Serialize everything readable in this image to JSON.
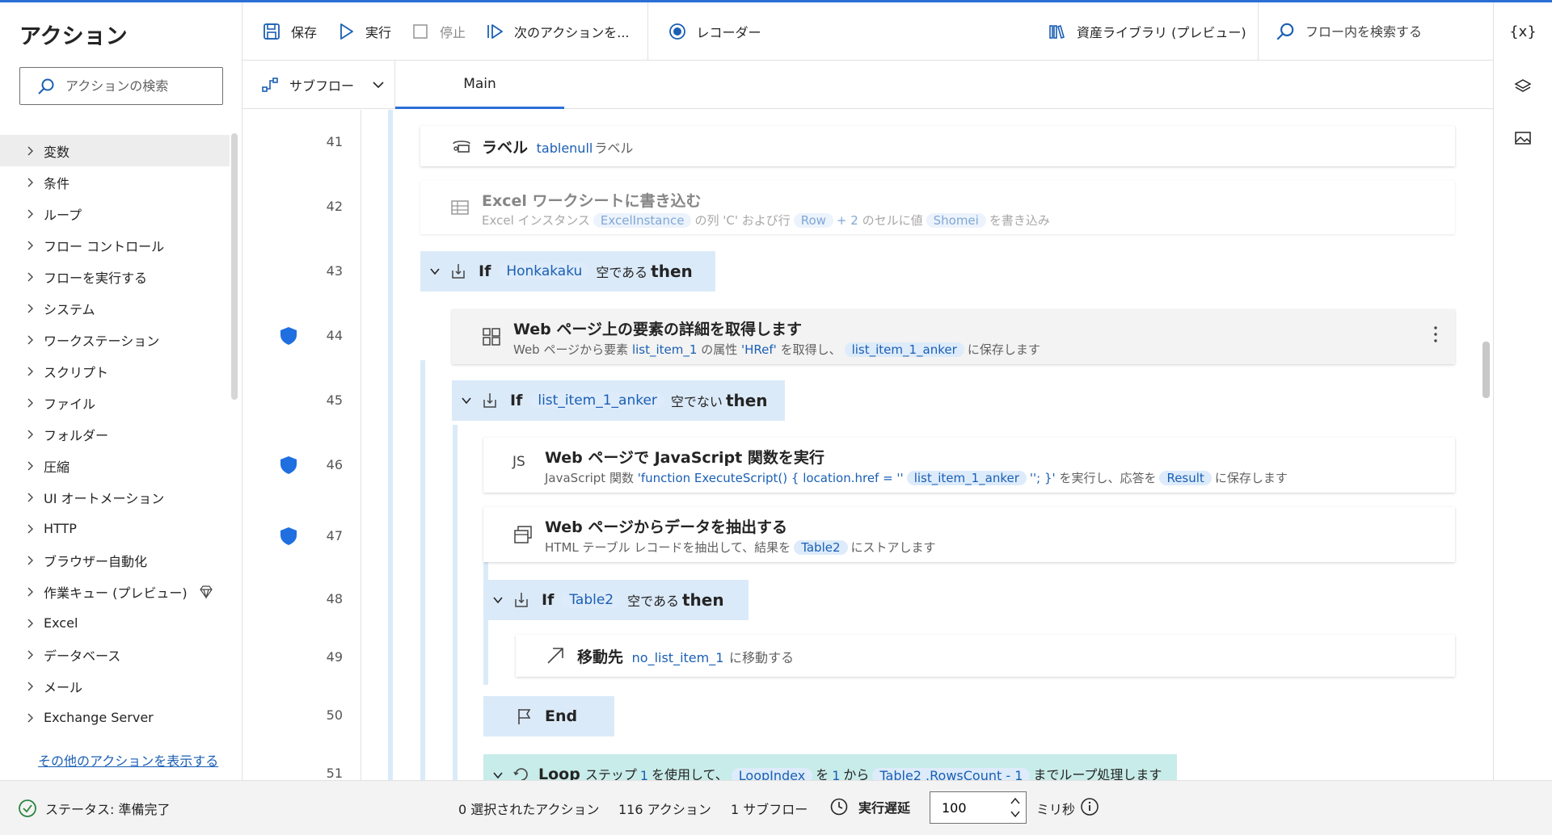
{
  "actions_pane": {
    "title": "アクション",
    "search_placeholder": "アクションの検索",
    "categories": [
      {
        "label": "変数"
      },
      {
        "label": "条件"
      },
      {
        "label": "ループ"
      },
      {
        "label": "フロー コントロール"
      },
      {
        "label": "フローを実行する"
      },
      {
        "label": "システム"
      },
      {
        "label": "ワークステーション"
      },
      {
        "label": "スクリプト"
      },
      {
        "label": "ファイル"
      },
      {
        "label": "フォルダー"
      },
      {
        "label": "圧縮"
      },
      {
        "label": "UI オートメーション"
      },
      {
        "label": "HTTP"
      },
      {
        "label": "ブラウザー自動化"
      },
      {
        "label": "作業キュー (プレビュー)"
      },
      {
        "label": "Excel"
      },
      {
        "label": "データベース"
      },
      {
        "label": "メール"
      },
      {
        "label": "Exchange Server"
      }
    ],
    "more_link": "その他のアクションを表示する"
  },
  "toolbar": {
    "save": "保存",
    "run": "実行",
    "stop": "停止",
    "next_action": "次のアクションを...",
    "recorder": "レコーダー",
    "asset_library": "資産ライブラリ (プレビュー)",
    "search_placeholder": "フロー内を検索する"
  },
  "tabs": {
    "subflow": "サブフロー",
    "main": "Main"
  },
  "right_rail": {
    "variables": "{x}"
  },
  "flow": {
    "line_numbers": [
      "41",
      "42",
      "43",
      "44",
      "45",
      "46",
      "47",
      "48",
      "49",
      "50",
      "51"
    ],
    "step41": {
      "title": "ラベル",
      "var": "tablenull",
      "suffix": "ラベル"
    },
    "step42": {
      "title": "Excel ワークシートに書き込む",
      "d1": "Excel インスタンス",
      "v1": "ExcelInstance",
      "d2": "の列 'C' および行",
      "v2": "Row",
      "d3": "+ 2",
      "d4": "のセルに値",
      "v3": "Shomei",
      "d5": "を書き込み"
    },
    "step43": {
      "if": "If",
      "var": "Honkakaku",
      "cond": "空である",
      "then": "then"
    },
    "step44": {
      "title": "Web ページ上の要素の詳細を取得します",
      "d1": "Web ページから要素",
      "v1": "list_item_1",
      "d2": "の属性",
      "v2": "'HRef'",
      "d3": "を取得し、",
      "v3": "list_item_1_anker",
      "d4": "に保存します"
    },
    "step45": {
      "if": "If",
      "var": "list_item_1_anker",
      "cond": "空でない",
      "then": "then"
    },
    "step46": {
      "icon": "JS",
      "title": "Web ページで JavaScript 関数を実行",
      "d1": "JavaScript 関数",
      "v1": "'function ExecuteScript() { location.href = ''",
      "v2": "list_item_1_anker",
      "v3": "''; }'",
      "d2": "を実行し、応答を",
      "v4": "Result",
      "d3": "に保存します"
    },
    "step47": {
      "title": "Web ページからデータを抽出する",
      "d1": "HTML テーブル レコードを抽出して、結果を",
      "v1": "Table2",
      "d2": "にストアします"
    },
    "step48": {
      "if": "If",
      "var": "Table2",
      "cond": "空である",
      "then": "then"
    },
    "step49": {
      "title": "移動先",
      "var": "no_list_item_1",
      "suffix": "に移動する"
    },
    "step50": {
      "label": "End"
    },
    "step51": {
      "loop": "Loop",
      "d1": "ステップ",
      "v1": "1",
      "d2": "を使用して、",
      "v2": "LoopIndex",
      "d3": "を",
      "v3": "1",
      "d4": "から",
      "v4": "Table2 .RowsCount - 1",
      "d5": "までループ処理します"
    }
  },
  "statusbar": {
    "status": "ステータス: 準備完了",
    "selected": "0 選択されたアクション",
    "actions": "116 アクション",
    "subflows": "1 サブフロー",
    "delay_label": "実行遅延",
    "delay_value": "100",
    "unit": "ミリ秒"
  },
  "colors": {
    "accent": "#2b6fd6",
    "variable_text": "#1a5fb4",
    "variable_pill": "#ddebfa",
    "if_block": "#dbeaf9",
    "loop_block": "#c8ece9",
    "shield": "#1f6fe0",
    "status_ok": "#2e8540"
  }
}
